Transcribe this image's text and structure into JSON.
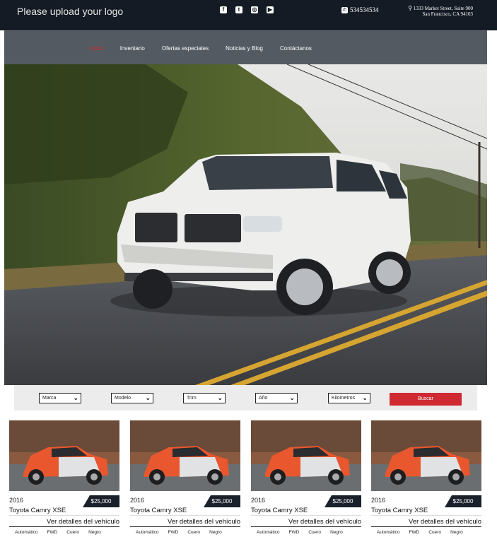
{
  "header": {
    "logo_text": "Please upload your logo",
    "social_icons": [
      "facebook-icon",
      "twitter-icon",
      "instagram-icon",
      "youtube-icon"
    ],
    "phone": "534534534",
    "address_line1": "1333 Market Street, Suite 900",
    "address_line2": "San Francisco, CA 94103"
  },
  "nav": {
    "items": [
      {
        "label": "Inicio",
        "active": true
      },
      {
        "label": "Inventario",
        "active": false
      },
      {
        "label": "Ofertas especiales",
        "active": false
      },
      {
        "label": "Noticias y Blog",
        "active": false
      },
      {
        "label": "Contáctanos",
        "active": false
      }
    ]
  },
  "search": {
    "filters": [
      "Marca",
      "Modelo",
      "Trim",
      "Año",
      "Kilometros"
    ],
    "button_label": "Buscar"
  },
  "colors": {
    "topbar": "#141b24",
    "navbar": "#545a61",
    "accent": "#cf2a32",
    "price_badge": "#1a212b"
  },
  "listings": [
    {
      "year": "2016",
      "price": "$25,000",
      "name": "Toyota Camry XSE",
      "detail_link": "Ver detalles del vehículo",
      "transmission": "Automático",
      "drive": "FWD",
      "interior": "Cuero",
      "color": "Negro"
    },
    {
      "year": "2016",
      "price": "$25,000",
      "name": "Toyota Camry XSE",
      "detail_link": "Ver detalles del vehículo",
      "transmission": "Automático",
      "drive": "FWD",
      "interior": "Cuero",
      "color": "Negro"
    },
    {
      "year": "2016",
      "price": "$25,000",
      "name": "Toyota Camry XSE",
      "detail_link": "Ver detalles del vehículo",
      "transmission": "Automático",
      "drive": "FWD",
      "interior": "Cuero",
      "color": "Negro"
    },
    {
      "year": "2016",
      "price": "$25,000",
      "name": "Toyota Camry XSE",
      "detail_link": "Ver detalles del vehículo",
      "transmission": "Automático",
      "drive": "FWD",
      "interior": "Cuero",
      "color": "Negro"
    }
  ]
}
